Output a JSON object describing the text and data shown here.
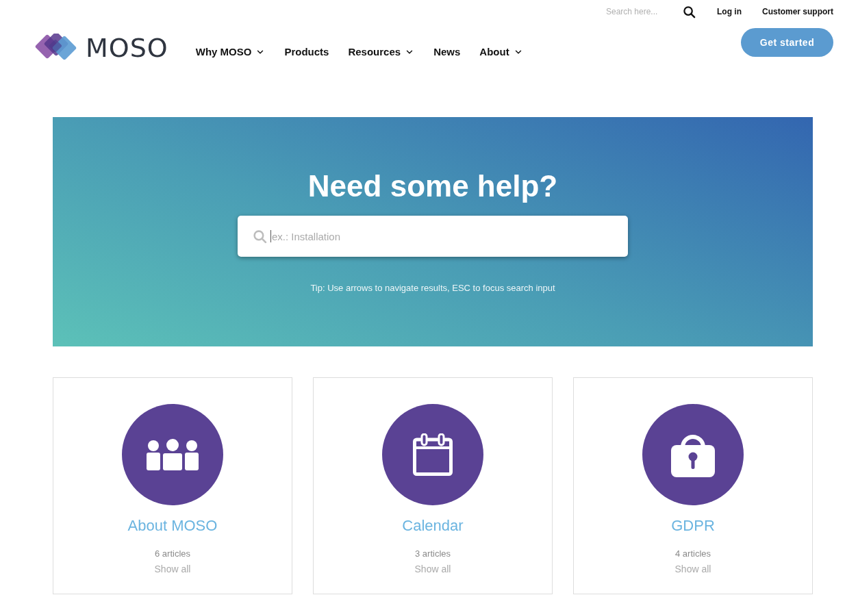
{
  "top_bar": {
    "search": {
      "placeholder": "Search here..."
    },
    "links": [
      "Log in",
      "Customer support"
    ]
  },
  "logo": {
    "text": "MOSO"
  },
  "nav": [
    {
      "label": "Why MOSO",
      "has_menu": true
    },
    {
      "label": "Products",
      "has_menu": false
    },
    {
      "label": "Resources",
      "has_menu": true
    },
    {
      "label": "News",
      "has_menu": false
    },
    {
      "label": "About",
      "has_menu": true
    }
  ],
  "cta_button": "Get started",
  "hero": {
    "title": "Need some help?",
    "search": {
      "placeholder": "ex.: Installation",
      "focused": true
    },
    "tip": "Tip: Use arrows to navigate results, ESC to focus search input"
  },
  "categories": [
    {
      "title": "About MOSO",
      "count": "6 articles",
      "link": "Show all"
    },
    {
      "title": "Calendar",
      "count": "3 articles",
      "link": "Show all"
    },
    {
      "title": "GDPR",
      "count": "4 articles",
      "link": "Show all"
    }
  ]
}
